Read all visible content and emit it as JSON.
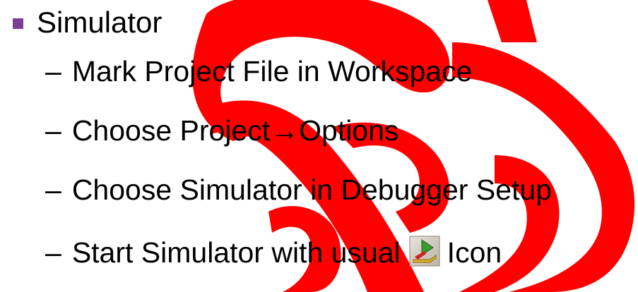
{
  "title": "Simulator",
  "bullets": [
    "Mark Project File in Workspace",
    "Choose Project→Options",
    "Choose Simulator in Debugger Setup"
  ],
  "last_bullet": {
    "before_icon": "Start Simulator with usual",
    "icon": "debug-start-icon",
    "after_icon": "Icon"
  },
  "dash_glyph": "–",
  "colors": {
    "bullet": "#7b3f97",
    "watermark": "#ff0000",
    "text": "#000000"
  }
}
